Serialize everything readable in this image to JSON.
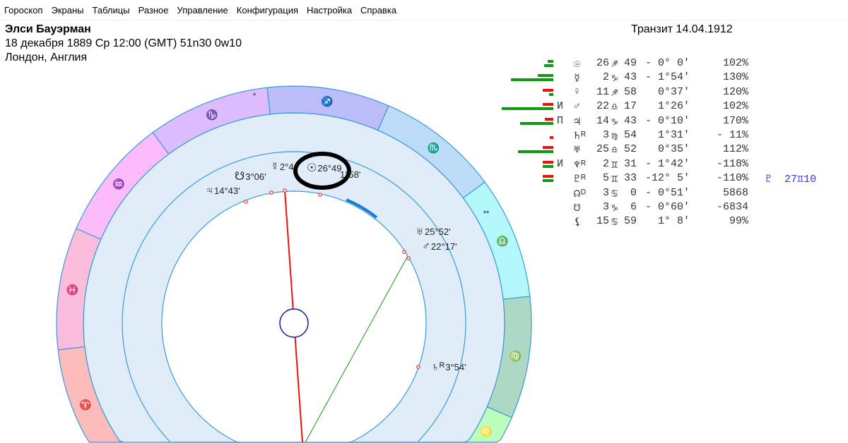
{
  "menu": [
    "Гороскоп",
    "Экраны",
    "Таблицы",
    "Разное",
    "Управление",
    "Конфигурация",
    "Настройка",
    "Справка"
  ],
  "header": {
    "name": "Элси Бауэрман",
    "birth": "18 декабря 1889  Ср  12:00 (GMT) 51n30  0w10",
    "place": "Лондон, Англия",
    "transit": "Транзит 14.04.1912"
  },
  "colors": {
    "ring_stroke": "#3a9ad9",
    "ring_fill": "#e0ecf8",
    "red": "#ee1111",
    "green": "#119911",
    "highlight": "#000000"
  },
  "zodiac": [
    {
      "sign": "sagittarius",
      "glyph": "♐",
      "color": "#bcbcf8"
    },
    {
      "sign": "scorpio",
      "glyph": "♏",
      "color": "#bcdcf8"
    },
    {
      "sign": "libra",
      "glyph": "♎",
      "color": "#b4f8fc"
    },
    {
      "sign": "virgo",
      "glyph": "♍",
      "color": "#acd8c4"
    },
    {
      "sign": "leo",
      "glyph": "♌",
      "color": "#bcfcbc"
    },
    {
      "sign": "capricorn",
      "glyph": "♑",
      "color": "#dcbcfc"
    },
    {
      "sign": "aquarius",
      "glyph": "♒",
      "color": "#fcbcfc"
    },
    {
      "sign": "pisces",
      "glyph": "♓",
      "color": "#fcbcdc"
    },
    {
      "sign": "aries",
      "glyph": "♈",
      "color": "#fcbcbc"
    }
  ],
  "zodiac_stars": [
    "*",
    "**"
  ],
  "chart_planets": [
    {
      "glyph": "♃",
      "text": "14°43'"
    },
    {
      "glyph": "☋",
      "text": "3°06'"
    },
    {
      "glyph": "☿",
      "text": "2°4"
    },
    {
      "glyph": "☉",
      "text": "26°49"
    },
    {
      "glyph": "",
      "text": "1°58'"
    },
    {
      "glyph": "♅",
      "text": "25°52'"
    },
    {
      "glyph": "♂",
      "text": "22°17'"
    },
    {
      "glyph": "♄ᴿ",
      "text": "3°54'"
    }
  ],
  "table": [
    {
      "flag": "",
      "glyph": "☉",
      "deg": "26",
      "sign": "♐",
      "min": "49",
      "orb": "- 0° 0'",
      "pct": "102%",
      "bars": [
        {
          "c": "green",
          "v": 8
        },
        {
          "c": "green",
          "v": 13
        }
      ]
    },
    {
      "flag": "",
      "glyph": "☿",
      "deg": "2",
      "sign": "♑",
      "min": "43",
      "orb": "- 1°54'",
      "pct": "130%",
      "bars": [
        {
          "c": "green",
          "v": 22
        },
        {
          "c": "green",
          "v": 60
        }
      ]
    },
    {
      "flag": "",
      "glyph": "♀",
      "deg": "11",
      "sign": "♐",
      "min": "58",
      "orb": "  0°37'",
      "pct": "120%",
      "bars": [
        {
          "c": "red",
          "v": 15
        },
        {
          "c": "green",
          "v": 6
        }
      ]
    },
    {
      "flag": "И",
      "glyph": "♂",
      "deg": "22",
      "sign": "♎",
      "min": "17",
      "orb": "  1°26'",
      "pct": "102%",
      "bars": [
        {
          "c": "red",
          "v": 15
        },
        {
          "c": "green",
          "v": 73
        }
      ]
    },
    {
      "flag": "П",
      "glyph": "♃",
      "deg": "14",
      "sign": "♑",
      "min": "43",
      "orb": "- 0°10'",
      "pct": "170%",
      "bars": [
        {
          "c": "red",
          "v": 12
        },
        {
          "c": "green",
          "v": 47
        }
      ]
    },
    {
      "flag": "",
      "glyph": "♄ᴿ",
      "deg": "3",
      "sign": "♍",
      "min": "54",
      "orb": "  1°31'",
      "pct": "- 11%",
      "bars": [
        {
          "c": "none",
          "v": 0
        },
        {
          "c": "red",
          "v": 5
        }
      ]
    },
    {
      "flag": "",
      "glyph": "♅",
      "deg": "25",
      "sign": "♎",
      "min": "52",
      "orb": "  0°35'",
      "pct": "112%",
      "bars": [
        {
          "c": "red",
          "v": 15
        },
        {
          "c": "green",
          "v": 50
        }
      ]
    },
    {
      "flag": "И",
      "glyph": "♆ᴿ",
      "deg": "2",
      "sign": "♊",
      "min": "31",
      "orb": "- 1°42'",
      "pct": "-118%",
      "bars": [
        {
          "c": "red",
          "v": 15
        },
        {
          "c": "green",
          "v": 15
        }
      ]
    },
    {
      "flag": "",
      "glyph": "♇ᴿ",
      "deg": "5",
      "sign": "♊",
      "min": "33",
      "orb": "-12° 5'",
      "pct": "-110%",
      "bars": [
        {
          "c": "red",
          "v": 15
        },
        {
          "c": "green",
          "v": 15
        }
      ],
      "extra": "♇  27♊10"
    },
    {
      "flag": "",
      "glyph": "☊ᴰ",
      "deg": "3",
      "sign": "♋",
      "min": " 0",
      "orb": "- 0°51'",
      "pct": "5868",
      "bars": []
    },
    {
      "flag": "",
      "glyph": "☋",
      "deg": "3",
      "sign": "♑",
      "min": " 6",
      "orb": "- 0°60'",
      "pct": "-6834",
      "bars": []
    },
    {
      "flag": "",
      "glyph": "⚸",
      "deg": "15",
      "sign": "♋",
      "min": "59",
      "orb": "  1° 8'",
      "pct": "99%",
      "bars": []
    }
  ]
}
